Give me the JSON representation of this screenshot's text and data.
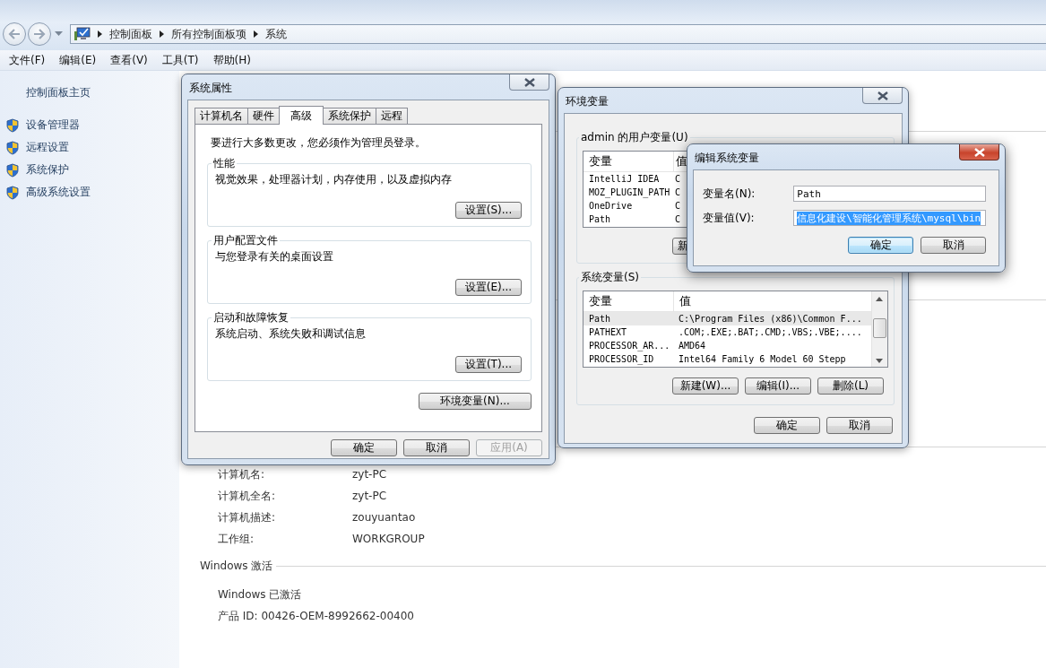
{
  "explorer": {
    "breadcrumb": [
      "控制面板",
      "所有控制面板项",
      "系统"
    ],
    "menu": [
      "文件(F)",
      "编辑(E)",
      "查看(V)",
      "工具(T)",
      "帮助(H)"
    ],
    "sidebar": {
      "home": "控制面板主页",
      "links": [
        "设备管理器",
        "远程设置",
        "系统保护",
        "高级系统设置"
      ]
    },
    "computer_info": [
      {
        "label": "计算机名:",
        "value": "zyt-PC"
      },
      {
        "label": "计算机全名:",
        "value": "zyt-PC"
      },
      {
        "label": "计算机描述:",
        "value": "zouyuantao"
      },
      {
        "label": "工作组:",
        "value": "WORKGROUP"
      }
    ],
    "activation": {
      "heading": "Windows 激活",
      "status": "Windows 已激活",
      "product_id": "产品 ID: 00426-OEM-8992662-00400"
    }
  },
  "system_properties": {
    "title": "系统属性",
    "tabs": [
      {
        "label": "计算机名",
        "selected": false
      },
      {
        "label": "硬件",
        "selected": false
      },
      {
        "label": "高级",
        "selected": true
      },
      {
        "label": "系统保护",
        "selected": false
      },
      {
        "label": "远程",
        "selected": false
      }
    ],
    "notice": "要进行大多数更改，您必须作为管理员登录。",
    "groups": [
      {
        "title": "性能",
        "description": "视觉效果，处理器计划，内存使用，以及虚拟内存",
        "button": "设置(S)..."
      },
      {
        "title": "用户配置文件",
        "description": "与您登录有关的桌面设置",
        "button": "设置(E)..."
      },
      {
        "title": "启动和故障恢复",
        "description": "系统启动、系统失败和调试信息",
        "button": "设置(T)..."
      }
    ],
    "env_button": "环境变量(N)...",
    "buttons": [
      {
        "label": "确定",
        "disabled": false
      },
      {
        "label": "取消",
        "disabled": false
      },
      {
        "label": "应用(A)",
        "disabled": true
      }
    ]
  },
  "environment_variables": {
    "title": "环境变量",
    "user_vars": {
      "label": "admin 的用户变量(U)",
      "columns": [
        "变量",
        "值"
      ],
      "rows": [
        {
          "name": "IntelliJ IDEA",
          "value": "C"
        },
        {
          "name": "MOZ_PLUGIN_PATH",
          "value": "C"
        },
        {
          "name": "OneDrive",
          "value": "C"
        },
        {
          "name": "Path",
          "value": "C"
        }
      ],
      "buttons": [
        "新"
      ]
    },
    "system_vars": {
      "label": "系统变量(S)",
      "columns": [
        "变量",
        "值"
      ],
      "rows": [
        {
          "name": "Path",
          "value": "C:\\Program Files (x86)\\Common F...",
          "selected": true
        },
        {
          "name": "PATHEXT",
          "value": ".COM;.EXE;.BAT;.CMD;.VBS;.VBE;....",
          "selected": false
        },
        {
          "name": "PROCESSOR_AR...",
          "value": "AMD64",
          "selected": false
        },
        {
          "name": "PROCESSOR_ID",
          "value": "Intel64 Family 6 Model 60 Stepp",
          "selected": false
        }
      ],
      "buttons": [
        "新建(W)...",
        "编辑(I)...",
        "删除(L)"
      ]
    },
    "buttons": [
      "确定",
      "取消"
    ]
  },
  "edit_dialog": {
    "title": "编辑系统变量",
    "name_label": "变量名(N):",
    "name_value": "Path",
    "value_label": "变量值(V):",
    "value_value": "信息化建设\\智能化管理系统\\mysql\\bin",
    "value_selected": true,
    "buttons": [
      {
        "label": "确定",
        "default": true
      },
      {
        "label": "取消",
        "default": false
      }
    ]
  }
}
